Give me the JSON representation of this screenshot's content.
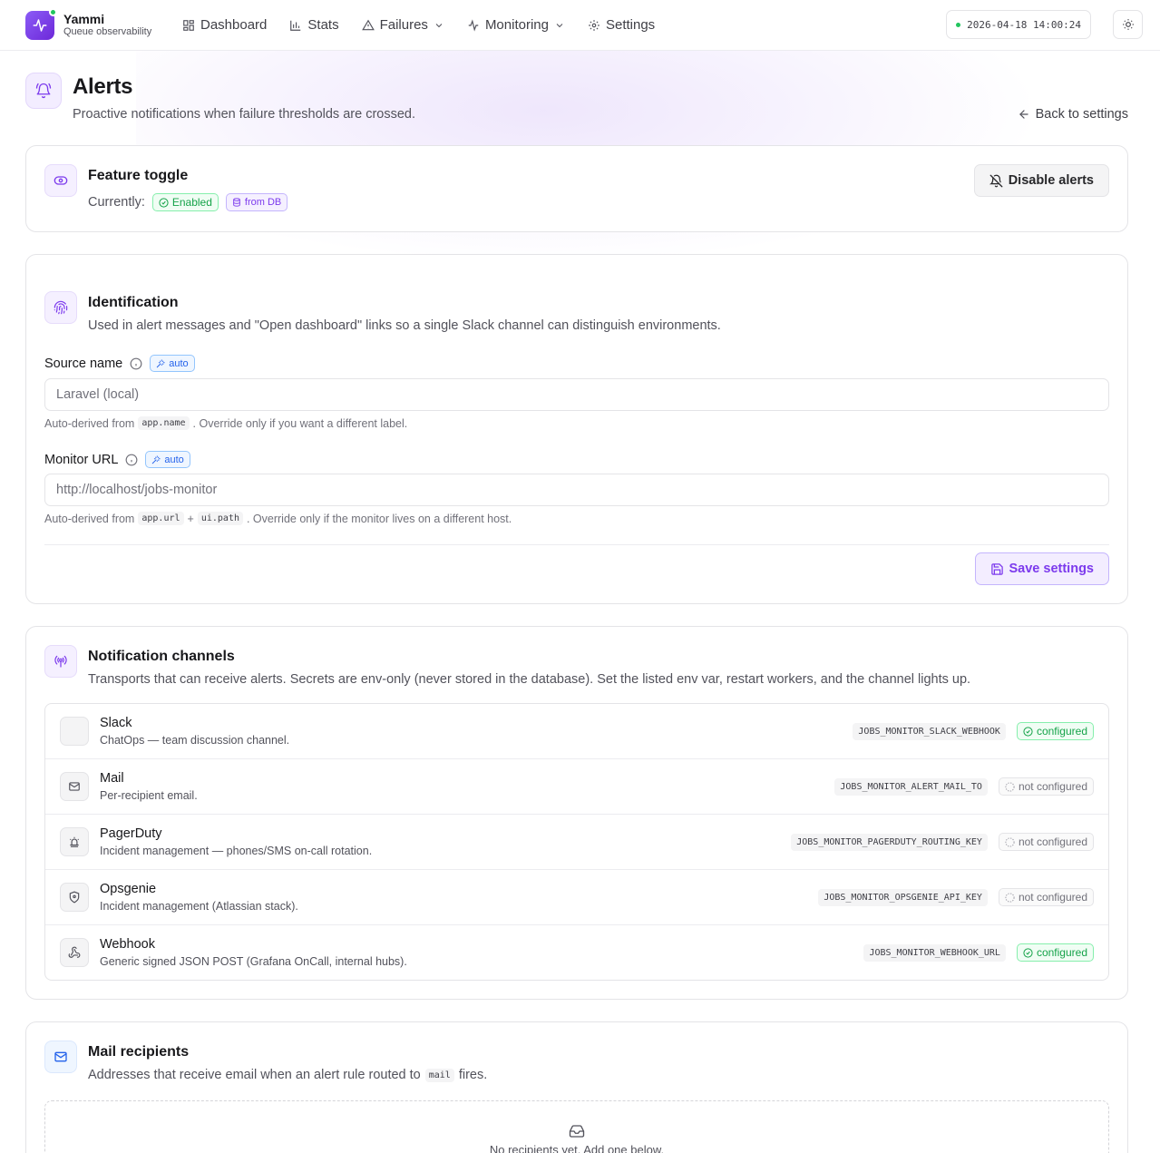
{
  "app": {
    "name": "Yammi",
    "tagline": "Queue observability"
  },
  "nav": {
    "items": [
      {
        "label": "Dashboard",
        "icon": "grid-icon"
      },
      {
        "label": "Stats",
        "icon": "bar-chart-icon"
      },
      {
        "label": "Failures",
        "icon": "warning-icon",
        "dropdown": true
      },
      {
        "label": "Monitoring",
        "icon": "activity-icon",
        "dropdown": true
      },
      {
        "label": "Settings",
        "icon": "gear-icon"
      }
    ],
    "clock": "2026-04-18 14:00:24"
  },
  "header": {
    "title": "Alerts",
    "subtitle": "Proactive notifications when failure thresholds are crossed.",
    "back_label": "Back to settings"
  },
  "feature_toggle": {
    "title": "Feature toggle",
    "currently_label": "Currently:",
    "status_badge": "Enabled",
    "source_badge": "from DB",
    "disable_button": "Disable alerts"
  },
  "identification": {
    "title": "Identification",
    "description": "Used in alert messages and \"Open dashboard\" links so a single Slack channel can distinguish environments.",
    "source_name": {
      "label": "Source name",
      "badge": "auto",
      "placeholder": "Laravel (local)",
      "hint_prefix": "Auto-derived from",
      "hint_code": "app.name",
      "hint_suffix": ". Override only if you want a different label."
    },
    "monitor_url": {
      "label": "Monitor URL",
      "badge": "auto",
      "placeholder": "http://localhost/jobs-monitor",
      "hint_prefix": "Auto-derived from",
      "hint_code1": "app.url",
      "hint_plus": "+",
      "hint_code2": "ui.path",
      "hint_suffix": ". Override only if the monitor lives on a different host."
    },
    "save_button": "Save settings"
  },
  "channels": {
    "title": "Notification channels",
    "description": "Transports that can receive alerts. Secrets are env-only (never stored in the database). Set the listed env var, restart workers, and the channel lights up.",
    "items": [
      {
        "name": "Slack",
        "description": "ChatOps — team discussion channel.",
        "env_var": "JOBS_MONITOR_SLACK_WEBHOOK",
        "status": "configured"
      },
      {
        "name": "Mail",
        "description": "Per-recipient email.",
        "env_var": "JOBS_MONITOR_ALERT_MAIL_TO",
        "status": "not configured"
      },
      {
        "name": "PagerDuty",
        "description": "Incident management — phones/SMS on-call rotation.",
        "env_var": "JOBS_MONITOR_PAGERDUTY_ROUTING_KEY",
        "status": "not configured"
      },
      {
        "name": "Opsgenie",
        "description": "Incident management (Atlassian stack).",
        "env_var": "JOBS_MONITOR_OPSGENIE_API_KEY",
        "status": "not configured"
      },
      {
        "name": "Webhook",
        "description": "Generic signed JSON POST (Grafana OnCall, internal hubs).",
        "env_var": "JOBS_MONITOR_WEBHOOK_URL",
        "status": "configured"
      }
    ]
  },
  "mail_recipients": {
    "title": "Mail recipients",
    "description_prefix": "Addresses that receive email when an alert rule routed to",
    "description_code": "mail",
    "description_suffix": "fires.",
    "empty_text": "No recipients yet. Add one below."
  },
  "colors": {
    "accent": "#7c3aed",
    "success": "#16a34a",
    "info": "#2563eb",
    "muted": "#71717a"
  }
}
